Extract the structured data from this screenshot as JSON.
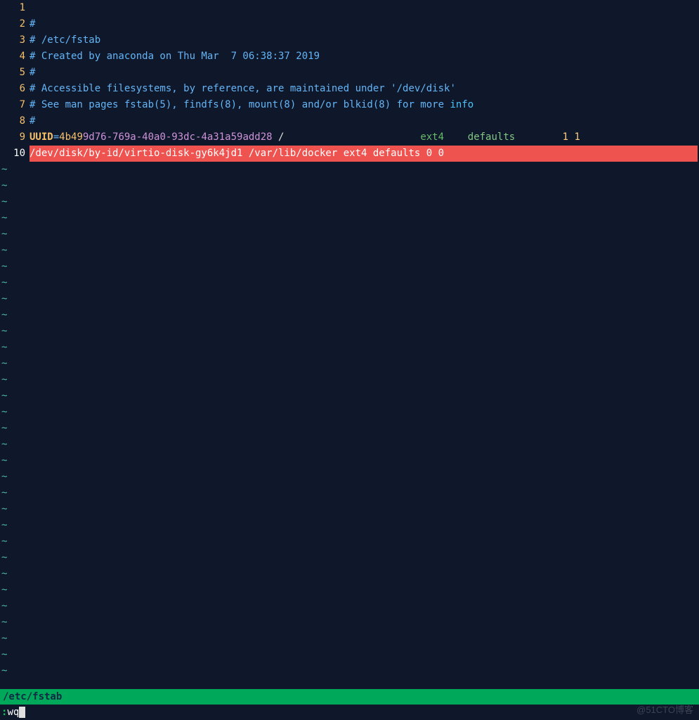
{
  "lines": {
    "n1": "1",
    "n2": "2",
    "n3": "3",
    "n4": "4",
    "n5": "5",
    "n6": "6",
    "n7": "7",
    "n8": "8",
    "n9": "9",
    "n10": "10",
    "l2": "#",
    "l3": "# /etc/fstab",
    "l4": "# Created by anaconda on Thu Mar  7 06:38:37 2019",
    "l5": "#",
    "l6": "# Accessible filesystems, by reference, are maintained under '/dev/disk'",
    "l7a": "# See man pages fstab(5), findfs(8), mount(8) and/or blkid(8) for more ",
    "l7b": "info",
    "l8": "#",
    "l9_uuid_key": "UUID",
    "l9_eq": "=",
    "l9_uuid_p1": "4b49",
    "l9_uuid_rest": "9d76-769a-40a0-93dc-4a31a59add28",
    "l9_slash": " /",
    "l9_pad1": "                       ",
    "l9_ext4": "ext4",
    "l9_pad2": "    ",
    "l9_defaults": "defaults",
    "l9_pad3": "        ",
    "l9_nums": "1 1",
    "l10": "/dev/disk/by-id/virtio-disk-gy6k4jd1 /var/lib/docker ext4 defaults 0 0"
  },
  "tilde": "~",
  "status": "/etc/fstab",
  "command_colon": ":",
  "command_text": "wq",
  "watermark": "@51CTO博客"
}
